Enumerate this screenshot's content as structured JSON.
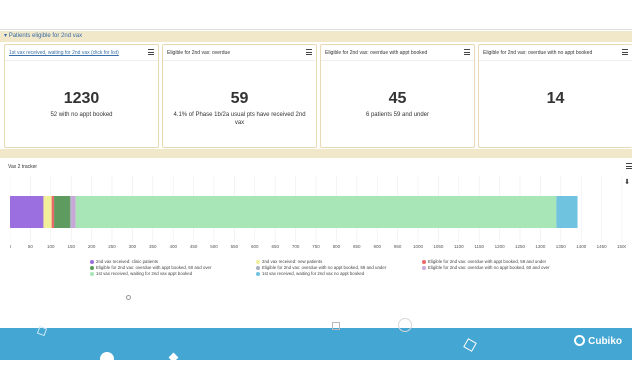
{
  "section": {
    "title": "Patients eligible for 2nd vax"
  },
  "cards": [
    {
      "title": "1st vax received, waiting for 2nd vax (click for list)",
      "value": "1230",
      "sub": "52 with no appt booked"
    },
    {
      "title": "Eligible for 2nd vax: overdue",
      "value": "59",
      "sub": "4.1% of Phase 1b/2a usual pts have received 2nd vax"
    },
    {
      "title": "Eligible for 2nd vax: overdue with appt booked",
      "value": "45",
      "sub": "6 patients 59 and under"
    },
    {
      "title": "Eligible for 2nd vax: overdue with no appt booked",
      "value": "14",
      "sub": ""
    }
  ],
  "tracker": {
    "title": "Vax 2 tracker"
  },
  "chart_data": {
    "type": "bar",
    "orientation": "horizontal-stacked",
    "xlim": [
      0,
      1500
    ],
    "ticks": [
      0,
      50,
      100,
      150,
      200,
      250,
      300,
      350,
      400,
      450,
      500,
      550,
      600,
      650,
      700,
      750,
      800,
      850,
      900,
      950,
      1000,
      1050,
      1100,
      1150,
      1200,
      1250,
      1300,
      1350,
      1400,
      1450,
      1500
    ],
    "series": [
      {
        "name": "2nd vax received: clinic patients",
        "value": 82,
        "color": "#9b6fe0"
      },
      {
        "name": "2nd vax received: new patients",
        "value": 20,
        "color": "#f2ef9a"
      },
      {
        "name": "Eligible for 2nd vax: overdue with appt booked, 59 and under",
        "value": 6,
        "color": "#e86a6a"
      },
      {
        "name": "Eligible for 2nd vax: overdue with appt booked, 60 and over",
        "value": 39,
        "color": "#5e9b5e"
      },
      {
        "name": "Eligible for 2nd vax: overdue with no appt booked, 59 and under",
        "value": 4,
        "color": "#aab0c0"
      },
      {
        "name": "Eligible for 2nd vax: overdue with no appt booked, 60 and over",
        "value": 10,
        "color": "#c9a7d6"
      },
      {
        "name": "1st vax received, waiting for 2nd vax appt booked",
        "value": 1178,
        "color": "#a8e6b8"
      },
      {
        "name": "1st vax received, waiting for 2nd vax no appt booked",
        "value": 52,
        "color": "#6fc3df"
      }
    ],
    "legend_columns": [
      [
        0,
        3,
        6
      ],
      [
        1,
        4,
        7
      ],
      [
        2,
        5
      ]
    ]
  },
  "footer": {
    "logo": "Cubiko"
  },
  "icons": {
    "chevron": "chevron-down-icon",
    "menu": "hamburger-menu-icon",
    "download": "download-icon"
  }
}
